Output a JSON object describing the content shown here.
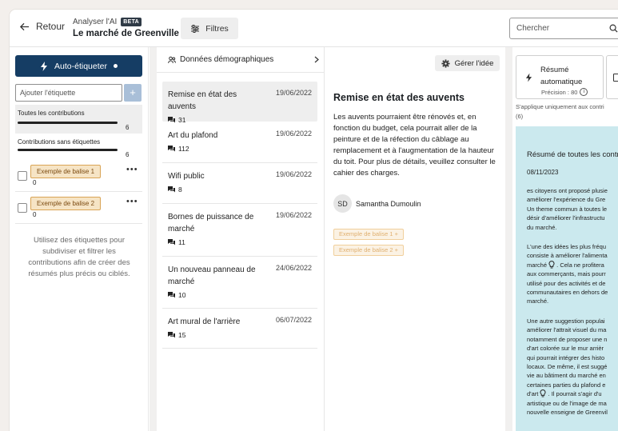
{
  "header": {
    "back_label": "Retour",
    "app_label": "Analyser l'AI",
    "beta_badge": "BETA",
    "project_title": "Le marché de Greenville",
    "filters_label": "Filtres",
    "search_placeholder": "Chercher"
  },
  "tags_panel": {
    "auto_tag_label": "Auto-étiqueter",
    "tag_input_placeholder": "Ajouter l'étiquette",
    "all_contributions_label": "Toutes les contributions",
    "all_contributions_count": "6",
    "untagged_label": "Contributions sans étiquettes",
    "untagged_count": "6",
    "tags": [
      {
        "label": "Exemple de balise 1",
        "count": "0"
      },
      {
        "label": "Exemple de balise 2",
        "count": "0"
      }
    ],
    "hint": "Utilisez des étiquettes pour subdiviser et filtrer les contributions afin de créer des résumés plus précis ou ciblés."
  },
  "ideas_panel": {
    "demographics_label": "Données démographiques",
    "ideas": [
      {
        "title": "Remise en état des auvents",
        "date": "19/06/2022",
        "count": "31"
      },
      {
        "title": "Art du plafond",
        "date": "19/06/2022",
        "count": "112"
      },
      {
        "title": "Wifi public",
        "date": "19/06/2022",
        "count": "8"
      },
      {
        "title": "Bornes de puissance de marché",
        "date": "19/06/2022",
        "count": "11"
      },
      {
        "title": "Un nouveau panneau de marché",
        "date": "24/06/2022",
        "count": "10"
      },
      {
        "title": "Art mural de l'arrière",
        "date": "06/07/2022",
        "count": "15"
      }
    ]
  },
  "detail_panel": {
    "manage_label": "Gérer l'idée",
    "title": "Remise en état des auvents",
    "body": "Les auvents pourraient être rénovés et, en fonction du budget, cela pourrait aller de la peinture et de la réfection du câblage au remplacement et à l'augmentation de la hauteur du toit. Pour plus de détails, veuillez consulter le cahier des charges.",
    "author_initials": "SD",
    "author_name": "Samantha Dumoulin",
    "tag_chips": [
      "Exemple de balise 1 +",
      "Exemple de balise 2 +"
    ]
  },
  "summary_panel": {
    "auto_summary_label": "Résumé automatique",
    "precision_label": "Précision : 80",
    "applies_text": "S'applique uniquement aux contri\n(6)",
    "summary_title": "Résumé de toutes les contr",
    "summary_date": "08/11/2023",
    "paragraph_1": "es citoyens ont proposé plusie\naméliorer l'expérience du Gre\nUn theme commun à toutes le\ndésir d'améliorer l'infrastructu\ndu marché.",
    "paragraph_2a": "L'une des idées les plus fréqu\nconsiste à améliorer l'alimenta\nmarché ",
    "paragraph_2b": " . Cela ne profitera\naux commerçants, mais pourr\nutilisé pour des activités et de\ncommunautaires en dehors de\nmarché.",
    "paragraph_3a": "Une autre suggestion populai\naméliorer l'attrait visuel du ma\nnotamment de proposer une n\nd'art colorée sur le mur arrièr\nqui pourrait intégrer des histo\nlocaux. De même, il est suggé\nvie au bâtiment du marché en\ncertaines parties du plafond e\nd'art ",
    "paragraph_3b": " . Il pourrait s'agir d'u\nartistique ou de l'image de ma\nnouvelle enseigne de Greenvil",
    "accent_color": "#153d64",
    "summary_bg": "#cbe9ee",
    "tag_color": "#f6e4c5"
  }
}
